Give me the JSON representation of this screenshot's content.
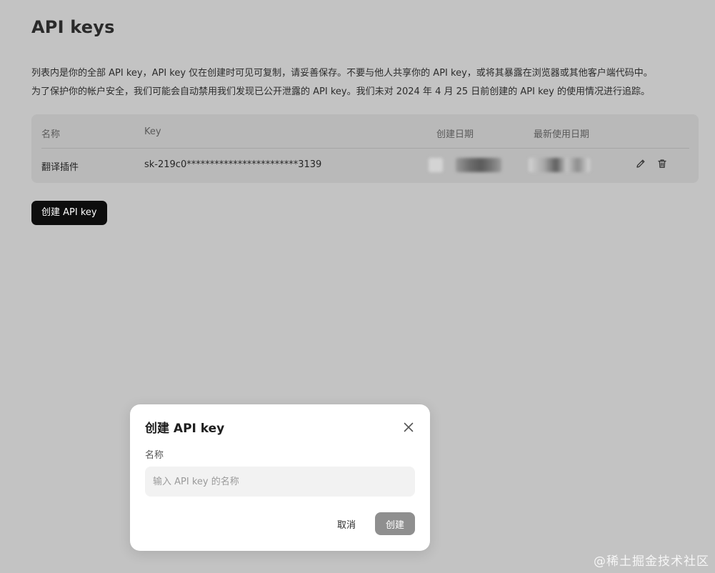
{
  "page": {
    "title": "API keys",
    "description": [
      "列表内是你的全部 API key，API key 仅在创建时可见可复制，请妥善保存。不要与他人共享你的 API key，或将其暴露在浏览器或其他客户端代码中。",
      "为了保护你的帐户安全，我们可能会自动禁用我们发现已公开泄露的 API key。我们未对 2024 年 4 月 25 日前创建的 API key 的使用情况进行追踪。"
    ]
  },
  "table": {
    "headers": {
      "name": "名称",
      "key": "Key",
      "created": "创建日期",
      "last_used": "最新使用日期"
    },
    "rows": [
      {
        "name": "翻译插件",
        "key": "sk-219c0************************3139"
      }
    ]
  },
  "actions": {
    "create_label": "创建 API key"
  },
  "modal": {
    "title": "创建 API key",
    "field_label": "名称",
    "input_placeholder": "输入 API key 的名称",
    "input_value": "",
    "cancel_label": "取消",
    "confirm_label": "创建"
  },
  "watermark": "@稀土掘金技术社区",
  "icons": {
    "edit": "pencil-icon",
    "delete": "trash-icon",
    "close": "close-icon"
  },
  "colors": {
    "overlay_bg": "#c3c3c3",
    "primary_button": "#0d0d0d",
    "confirm_button_disabled": "#8f8f8f",
    "modal_bg": "#ffffff"
  }
}
